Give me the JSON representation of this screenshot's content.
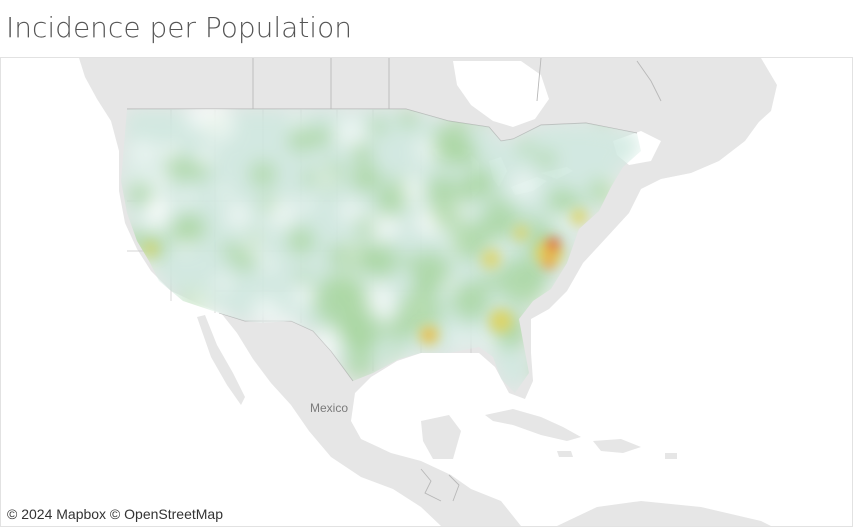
{
  "title": "Incidence per Population",
  "attribution": "© 2024 Mapbox © OpenStreetMap",
  "place_labels": {
    "mexico": "Mexico"
  },
  "colors": {
    "land": "#e6e6e6",
    "water": "#ffffff",
    "border": "#b8b8b8",
    "heat_low": "#cfe9df",
    "heat_mid": "#a9d6a0",
    "heat_high": "#e0d25b",
    "heat_peak": "#e8462c"
  },
  "legend_present": false,
  "heatmap": {
    "metric": "Incidence per Population",
    "hotspots": [
      {
        "region": "southeastern Virginia / northeastern North Carolina",
        "level": "peak"
      },
      {
        "region": "Maryland / Delaware",
        "level": "high"
      },
      {
        "region": "South Carolina / Georgia",
        "level": "high"
      },
      {
        "region": "Louisiana",
        "level": "high"
      },
      {
        "region": "central California",
        "level": "medium"
      },
      {
        "region": "Texas",
        "level": "medium"
      },
      {
        "region": "Florida",
        "level": "medium"
      }
    ]
  }
}
